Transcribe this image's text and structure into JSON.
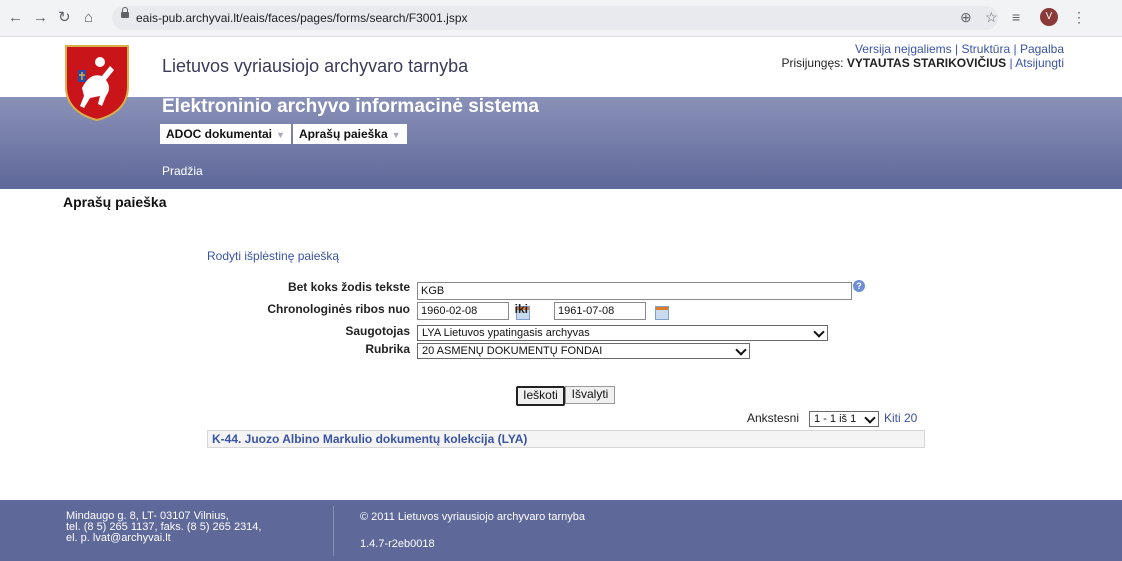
{
  "browser": {
    "url": "eais-pub.archyvai.lt/eais/faces/pages/forms/search/F3001.jspx",
    "avatar_letter": "V"
  },
  "header": {
    "site_name": "Lietuvos vyriausiojo archyvaro tarnyba",
    "links": [
      "Versija neįgaliems",
      "Struktūra",
      "Pagalba"
    ],
    "logged_in_label": "Prisijungęs:",
    "username": "VYTAUTAS STARIKOVIČIUS",
    "logout": "Atsijungti",
    "system_title": "Elektroninio archyvo informacinė sistema",
    "menu": [
      "ADOC dokumentai",
      "Aprašų paieška"
    ],
    "breadcrumb": "Pradžia"
  },
  "page": {
    "title": "Aprašų paieška",
    "advanced_link": "Rodyti išplėstinę paiešką"
  },
  "form": {
    "any_word_label": "Bet koks žodis tekste",
    "any_word_value": "KGB",
    "chron_label": "Chronologinės ribos nuo",
    "date_from": "1960-02-08",
    "iki_label": "iki",
    "date_to": "1961-07-08",
    "keeper_label": "Saugotojas",
    "keeper_value": "LYA Lietuvos ypatingasis archyvas",
    "rubric_label": "Rubrika",
    "rubric_value": "20 ASMENŲ DOKUMENTŲ FONDAI",
    "search_button": "Ieškoti",
    "clear_button": "Išvalyti"
  },
  "pager": {
    "prev": "Ankstesni",
    "range": "1 - 1 iš 1",
    "next": "Kiti 20"
  },
  "results": [
    "K-44. Juozo Albino Markulio dokumentų kolekcija (LYA)"
  ],
  "footer": {
    "address_lines": [
      "Mindaugo g. 8, LT- 03107 Vilnius,",
      "tel. (8 5) 265 1137, faks. (8 5) 265 2314,",
      "el. p. lvat@archyvai.lt"
    ],
    "copyright": "© 2011 Lietuvos vyriausiojo archyvaro tarnyba",
    "version": "1.4.7-r2eb0018"
  },
  "colors": {
    "header_band": "#6f78a8",
    "footer_band": "#5e6899",
    "link": "#3a53a4"
  }
}
